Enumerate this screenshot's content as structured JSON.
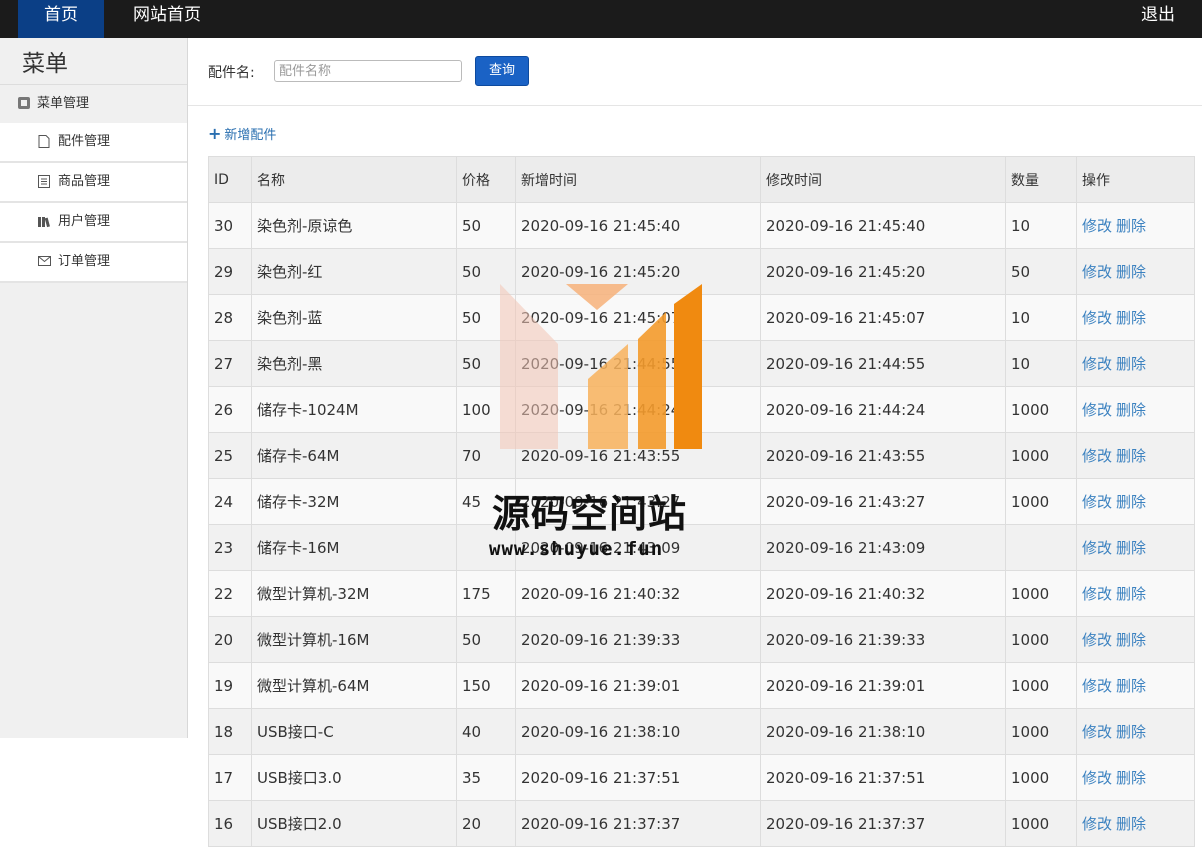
{
  "topbar": {
    "home": "首页",
    "site": "网站首页",
    "logout": "退出"
  },
  "sidebar": {
    "title": "菜单",
    "group": "菜单管理",
    "items": [
      {
        "label": "配件管理",
        "icon": "file-icon"
      },
      {
        "label": "商品管理",
        "icon": "list-icon"
      },
      {
        "label": "用户管理",
        "icon": "books-icon"
      },
      {
        "label": "订单管理",
        "icon": "envelope-icon"
      }
    ]
  },
  "search": {
    "label": "配件名:",
    "placeholder": "配件名称",
    "value": "",
    "button": "查询"
  },
  "add_label": "新增配件",
  "table": {
    "headers": [
      "ID",
      "名称",
      "价格",
      "新增时间",
      "修改时间",
      "数量",
      "操作"
    ],
    "edit": "修改",
    "delete": "删除",
    "rows": [
      {
        "id": "30",
        "name": "染色剂-原谅色",
        "price": "50",
        "created": "2020-09-16 21:45:40",
        "modified": "2020-09-16 21:45:40",
        "qty": "10"
      },
      {
        "id": "29",
        "name": "染色剂-红",
        "price": "50",
        "created": "2020-09-16 21:45:20",
        "modified": "2020-09-16 21:45:20",
        "qty": "50"
      },
      {
        "id": "28",
        "name": "染色剂-蓝",
        "price": "50",
        "created": "2020-09-16 21:45:07",
        "modified": "2020-09-16 21:45:07",
        "qty": "10"
      },
      {
        "id": "27",
        "name": "染色剂-黑",
        "price": "50",
        "created": "2020-09-16 21:44:55",
        "modified": "2020-09-16 21:44:55",
        "qty": "10"
      },
      {
        "id": "26",
        "name": "储存卡-1024M",
        "price": "100",
        "created": "2020-09-16 21:44:24",
        "modified": "2020-09-16 21:44:24",
        "qty": "1000"
      },
      {
        "id": "25",
        "name": "储存卡-64M",
        "price": "70",
        "created": "2020-09-16 21:43:55",
        "modified": "2020-09-16 21:43:55",
        "qty": "1000"
      },
      {
        "id": "24",
        "name": "储存卡-32M",
        "price": "45",
        "created": "2020-09-16 21:43:27",
        "modified": "2020-09-16 21:43:27",
        "qty": "1000"
      },
      {
        "id": "23",
        "name": "储存卡-16M",
        "price": "",
        "created": "2020-09-16 21:43:09",
        "modified": "2020-09-16 21:43:09",
        "qty": ""
      },
      {
        "id": "22",
        "name": "微型计算机-32M",
        "price": "175",
        "created": "2020-09-16 21:40:32",
        "modified": "2020-09-16 21:40:32",
        "qty": "1000"
      },
      {
        "id": "20",
        "name": "微型计算机-16M",
        "price": "50",
        "created": "2020-09-16 21:39:33",
        "modified": "2020-09-16 21:39:33",
        "qty": "1000"
      },
      {
        "id": "19",
        "name": "微型计算机-64M",
        "price": "150",
        "created": "2020-09-16 21:39:01",
        "modified": "2020-09-16 21:39:01",
        "qty": "1000"
      },
      {
        "id": "18",
        "name": "USB接口-C",
        "price": "40",
        "created": "2020-09-16 21:38:10",
        "modified": "2020-09-16 21:38:10",
        "qty": "1000"
      },
      {
        "id": "17",
        "name": "USB接口3.0",
        "price": "35",
        "created": "2020-09-16 21:37:51",
        "modified": "2020-09-16 21:37:51",
        "qty": "1000"
      },
      {
        "id": "16",
        "name": "USB接口2.0",
        "price": "20",
        "created": "2020-09-16 21:37:37",
        "modified": "2020-09-16 21:37:37",
        "qty": "1000"
      }
    ]
  },
  "watermark": {
    "text": "源码空间站",
    "url": "www.shuyue.fun"
  },
  "colors": {
    "topbar": "#1b1b1b",
    "active_nav": "#0b3f86",
    "primary_button": "#1a62c5",
    "link": "#3c82c0"
  }
}
